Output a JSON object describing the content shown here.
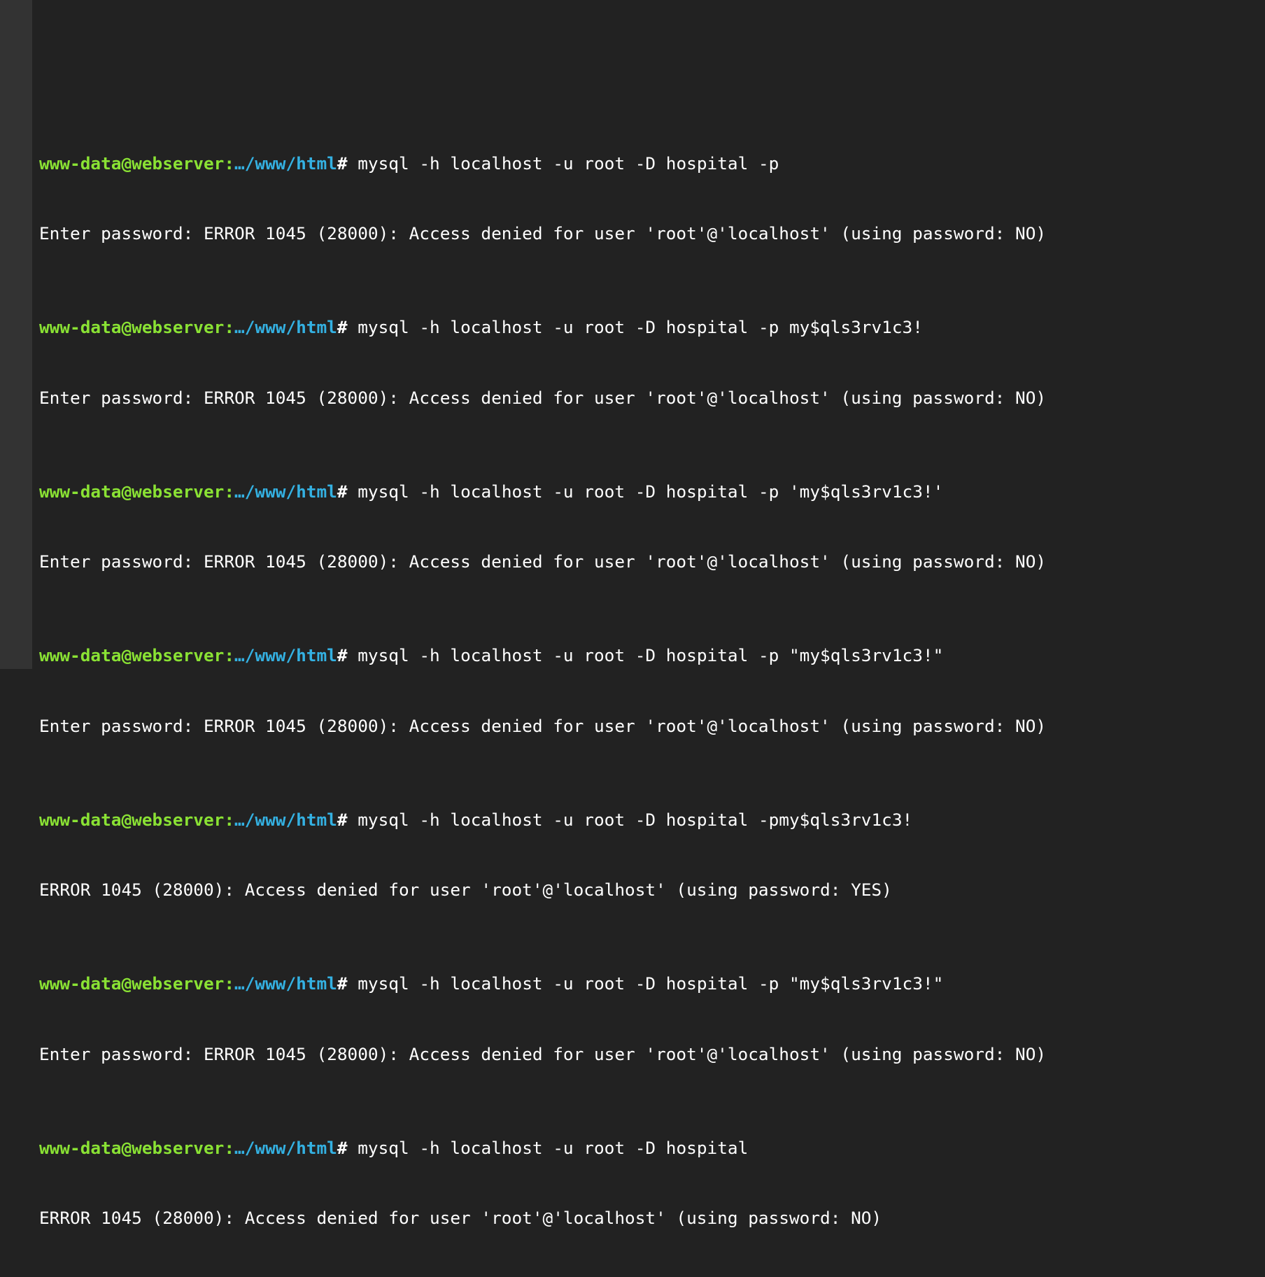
{
  "terminal": {
    "prompt_user": "www-data@webserver:",
    "prompt_path": "…/www/html",
    "prompt_symbol": "#",
    "entries": [
      {
        "command": " mysql -h localhost -u root -D hospital -p",
        "output": "Enter password: ERROR 1045 (28000): Access denied for user 'root'@'localhost' (using password: NO)"
      },
      {
        "command": " mysql -h localhost -u root -D hospital -p my$qls3rv1c3!",
        "output": "Enter password: ERROR 1045 (28000): Access denied for user 'root'@'localhost' (using password: NO)"
      },
      {
        "command": " mysql -h localhost -u root -D hospital -p 'my$qls3rv1c3!'",
        "output": "Enter password: ERROR 1045 (28000): Access denied for user 'root'@'localhost' (using password: NO)"
      },
      {
        "command": " mysql -h localhost -u root -D hospital -p \"my$qls3rv1c3!\"",
        "output": "Enter password: ERROR 1045 (28000): Access denied for user 'root'@'localhost' (using password: NO)"
      },
      {
        "command": " mysql -h localhost -u root -D hospital -pmy$qls3rv1c3!",
        "output": "ERROR 1045 (28000): Access denied for user 'root'@'localhost' (using password: YES)"
      },
      {
        "command": " mysql -h localhost -u root -D hospital -p \"my$qls3rv1c3!\"",
        "output": "Enter password: ERROR 1045 (28000): Access denied for user 'root'@'localhost' (using password: NO)"
      },
      {
        "command": " mysql -h localhost -u root -D hospital",
        "output": "ERROR 1045 (28000): Access denied for user 'root'@'localhost' (using password: NO)"
      }
    ]
  }
}
